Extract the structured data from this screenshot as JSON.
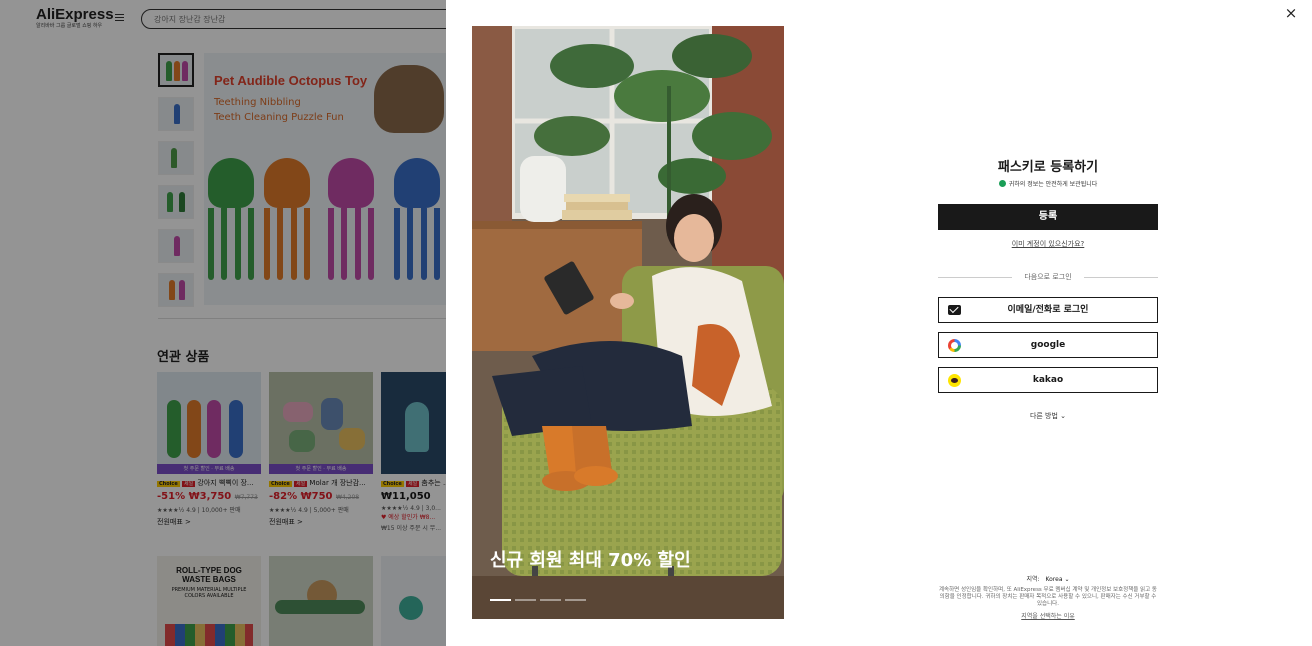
{
  "background": {
    "logo": "AliExpress",
    "logo_sub": "알리바바 그룹 글로벌 쇼핑 하우",
    "search_placeholder": "강아지 장난감 장난감",
    "hero": {
      "title": "Pet Audible Octopus Toy",
      "sub1": "Teething  Nibbling",
      "sub2": "Teeth Cleaning  Puzzle  Fun"
    },
    "related_title": "연관 상품",
    "products": [
      {
        "band": "첫 주문 할인 · 무료 배송",
        "choice": "Choice",
        "sale": "세일",
        "name": "강아지 삑삑이 장...",
        "discount": "-51%",
        "price": "₩3,750",
        "old_price": "₩7,773",
        "rating": "★★★★½ 4.9 | 10,000+ 판매",
        "view": "전원매표 >"
      },
      {
        "band": "첫 주문 할인 · 무료 배송",
        "choice": "Choice",
        "sale": "세일",
        "name": "Molar 개 장난감...",
        "discount": "-82%",
        "price": "₩750",
        "old_price": "₩4,208",
        "rating": "★★★★½ 4.9 | 5,000+ 판매",
        "view": "전원매표 >"
      },
      {
        "choice": "Choice",
        "sale": "세일",
        "name": "춤추는 ...",
        "price": "₩11,050",
        "rating": "★★★★½ 4.9 | 3,0...",
        "note_red": "♥ 예상 할인가 ₩8...",
        "note_grey": "₩15 이상 주문 시 무..."
      }
    ],
    "roll_title": "ROLL-TYPE DOG WASTE BAGS",
    "roll_sub": "PREMIUM MATERIAL MULTIPLE COLORS AVAILABLE"
  },
  "modal": {
    "close_label": "×",
    "promo_text": "신규 회원 최대 70% 할인",
    "title": "패스키로 등록하기",
    "secure_text": "귀하의 정보는 안전하게 보관됩니다",
    "register_label": "등록",
    "has_account": "이미 계정이 있으신가요?",
    "divider_text": "다음으로 로그인",
    "login_options": [
      {
        "label": "이메일/전화로 로그인",
        "icon": "mail-icon"
      },
      {
        "label": "google",
        "icon": "google-icon"
      },
      {
        "label": "kakao",
        "icon": "kakao-icon"
      }
    ],
    "more_ways": "다른 방법",
    "region_label": "지역:",
    "region_value": "Korea",
    "legal_pre": "계속하면 성인임을 확인하며, 또 AliExpress 무료 멤버십 계약 및 개인정보 보호정책을 읽고 동의함을 인정합니다. 귀하의 장치는 판매자 목적으로 사용할 수 있으니, 판매자는 수신 거부할 수 있습니다.",
    "region_reason": "지역을 선택하는 이유"
  },
  "colors": {
    "primary_button": "#191919",
    "secure_green": "#1a9e57",
    "sale_red": "#e0202a",
    "choice_yellow": "#ffcc00",
    "band_purple": "#7b4fc8"
  }
}
